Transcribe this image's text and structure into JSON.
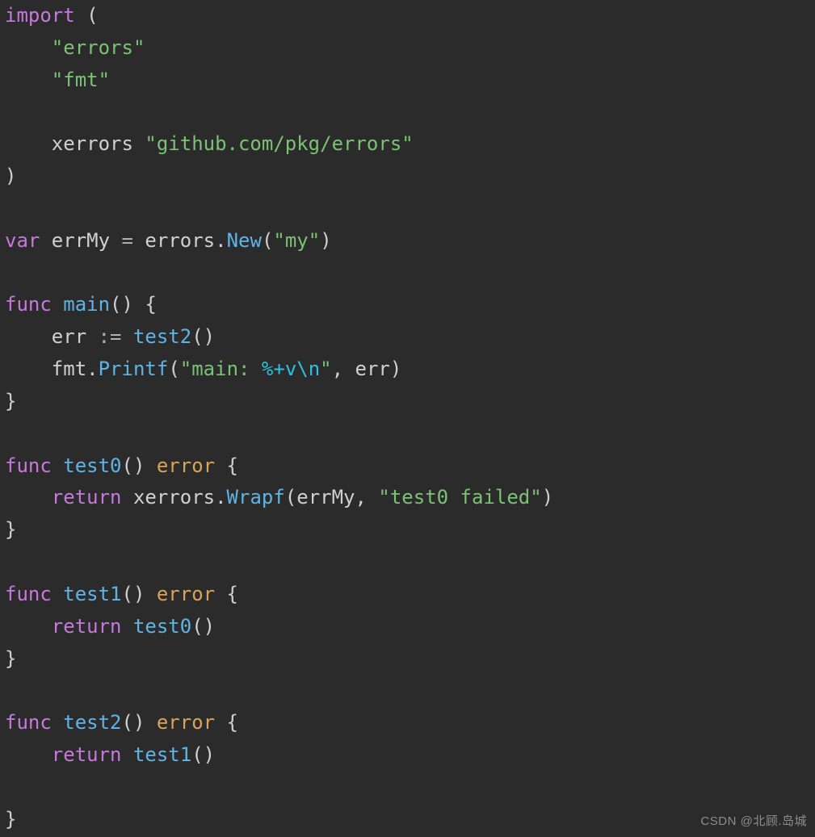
{
  "tokens": [
    {
      "cls": "kw",
      "t": "import"
    },
    {
      "cls": "punc",
      "t": " ("
    },
    {
      "cls": "",
      "t": "\n"
    },
    {
      "cls": "",
      "t": "    "
    },
    {
      "cls": "str",
      "t": "\"errors\""
    },
    {
      "cls": "",
      "t": "\n"
    },
    {
      "cls": "",
      "t": "    "
    },
    {
      "cls": "str",
      "t": "\"fmt\""
    },
    {
      "cls": "",
      "t": "\n"
    },
    {
      "cls": "",
      "t": "\n"
    },
    {
      "cls": "",
      "t": "    "
    },
    {
      "cls": "ident",
      "t": "xerrors "
    },
    {
      "cls": "str",
      "t": "\"github.com/pkg/errors\""
    },
    {
      "cls": "",
      "t": "\n"
    },
    {
      "cls": "punc",
      "t": ")"
    },
    {
      "cls": "",
      "t": "\n"
    },
    {
      "cls": "",
      "t": "\n"
    },
    {
      "cls": "kw",
      "t": "var"
    },
    {
      "cls": "ident",
      "t": " errMy "
    },
    {
      "cls": "op",
      "t": "="
    },
    {
      "cls": "ident",
      "t": " errors"
    },
    {
      "cls": "punc",
      "t": "."
    },
    {
      "cls": "fn",
      "t": "New"
    },
    {
      "cls": "punc",
      "t": "("
    },
    {
      "cls": "str",
      "t": "\"my\""
    },
    {
      "cls": "punc",
      "t": ")"
    },
    {
      "cls": "",
      "t": "\n"
    },
    {
      "cls": "",
      "t": "\n"
    },
    {
      "cls": "kw",
      "t": "func"
    },
    {
      "cls": "ident",
      "t": " "
    },
    {
      "cls": "fn",
      "t": "main"
    },
    {
      "cls": "punc",
      "t": "() {"
    },
    {
      "cls": "",
      "t": "\n"
    },
    {
      "cls": "",
      "t": "    "
    },
    {
      "cls": "ident",
      "t": "err "
    },
    {
      "cls": "op",
      "t": ":="
    },
    {
      "cls": "ident",
      "t": " "
    },
    {
      "cls": "fn",
      "t": "test2"
    },
    {
      "cls": "punc",
      "t": "()"
    },
    {
      "cls": "",
      "t": "\n"
    },
    {
      "cls": "",
      "t": "    "
    },
    {
      "cls": "ident",
      "t": "fmt"
    },
    {
      "cls": "punc",
      "t": "."
    },
    {
      "cls": "fn",
      "t": "Printf"
    },
    {
      "cls": "punc",
      "t": "("
    },
    {
      "cls": "str",
      "t": "\"main: "
    },
    {
      "cls": "esc",
      "t": "%+v\\n"
    },
    {
      "cls": "str",
      "t": "\""
    },
    {
      "cls": "punc",
      "t": ", "
    },
    {
      "cls": "ident",
      "t": "err"
    },
    {
      "cls": "punc",
      "t": ")"
    },
    {
      "cls": "",
      "t": "\n"
    },
    {
      "cls": "punc",
      "t": "}"
    },
    {
      "cls": "",
      "t": "\n"
    },
    {
      "cls": "",
      "t": "\n"
    },
    {
      "cls": "kw",
      "t": "func"
    },
    {
      "cls": "ident",
      "t": " "
    },
    {
      "cls": "fn",
      "t": "test0"
    },
    {
      "cls": "punc",
      "t": "() "
    },
    {
      "cls": "type",
      "t": "error"
    },
    {
      "cls": "punc",
      "t": " {"
    },
    {
      "cls": "",
      "t": "\n"
    },
    {
      "cls": "",
      "t": "    "
    },
    {
      "cls": "kw",
      "t": "return"
    },
    {
      "cls": "ident",
      "t": " xerrors"
    },
    {
      "cls": "punc",
      "t": "."
    },
    {
      "cls": "fn",
      "t": "Wrapf"
    },
    {
      "cls": "punc",
      "t": "("
    },
    {
      "cls": "ident",
      "t": "errMy"
    },
    {
      "cls": "punc",
      "t": ", "
    },
    {
      "cls": "str",
      "t": "\"test0 failed\""
    },
    {
      "cls": "punc",
      "t": ")"
    },
    {
      "cls": "",
      "t": "\n"
    },
    {
      "cls": "punc",
      "t": "}"
    },
    {
      "cls": "",
      "t": "\n"
    },
    {
      "cls": "",
      "t": "\n"
    },
    {
      "cls": "kw",
      "t": "func"
    },
    {
      "cls": "ident",
      "t": " "
    },
    {
      "cls": "fn",
      "t": "test1"
    },
    {
      "cls": "punc",
      "t": "() "
    },
    {
      "cls": "type",
      "t": "error"
    },
    {
      "cls": "punc",
      "t": " {"
    },
    {
      "cls": "",
      "t": "\n"
    },
    {
      "cls": "",
      "t": "    "
    },
    {
      "cls": "kw",
      "t": "return"
    },
    {
      "cls": "ident",
      "t": " "
    },
    {
      "cls": "fn",
      "t": "test0"
    },
    {
      "cls": "punc",
      "t": "()"
    },
    {
      "cls": "",
      "t": "\n"
    },
    {
      "cls": "punc",
      "t": "}"
    },
    {
      "cls": "",
      "t": "\n"
    },
    {
      "cls": "",
      "t": "\n"
    },
    {
      "cls": "kw",
      "t": "func"
    },
    {
      "cls": "ident",
      "t": " "
    },
    {
      "cls": "fn",
      "t": "test2"
    },
    {
      "cls": "punc",
      "t": "() "
    },
    {
      "cls": "type",
      "t": "error"
    },
    {
      "cls": "punc",
      "t": " {"
    },
    {
      "cls": "",
      "t": "\n"
    },
    {
      "cls": "",
      "t": "    "
    },
    {
      "cls": "kw",
      "t": "return"
    },
    {
      "cls": "ident",
      "t": " "
    },
    {
      "cls": "fn",
      "t": "test1"
    },
    {
      "cls": "punc",
      "t": "()"
    },
    {
      "cls": "",
      "t": "\n"
    },
    {
      "cls": "",
      "t": "\n"
    },
    {
      "cls": "punc",
      "t": "}"
    }
  ],
  "watermark": "CSDN @北顾.岛城"
}
